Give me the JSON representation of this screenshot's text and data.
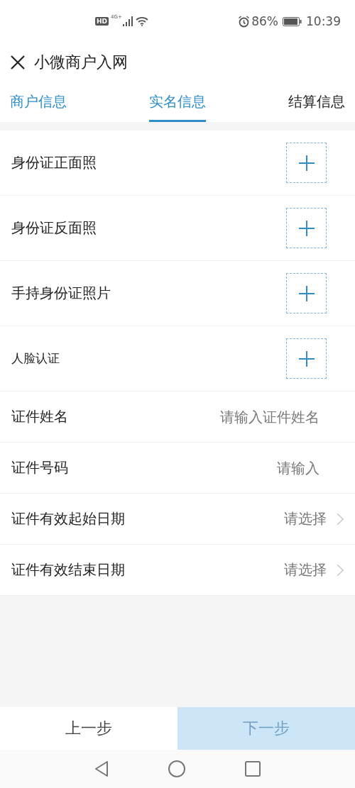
{
  "status_bar": {
    "hd": "HD",
    "network": "4G+",
    "battery": "86%",
    "time": "10:39"
  },
  "header": {
    "title": "小微商户入网"
  },
  "tabs": [
    {
      "label": "商户信息",
      "selected": false,
      "completed": true
    },
    {
      "label": "实名信息",
      "selected": true,
      "completed": false
    },
    {
      "label": "结算信息",
      "selected": false,
      "completed": false
    }
  ],
  "form": [
    {
      "kind": "upload",
      "label": "身份证正面照",
      "small": false
    },
    {
      "kind": "upload",
      "label": "身份证反面照",
      "small": false
    },
    {
      "kind": "upload",
      "label": "手持身份证照片",
      "small": false
    },
    {
      "kind": "upload",
      "label": "人脸认证",
      "small": true
    },
    {
      "kind": "input",
      "label": "证件姓名",
      "placeholder": "请输入证件姓名"
    },
    {
      "kind": "input",
      "label": "证件号码",
      "placeholder": "请输入"
    },
    {
      "kind": "select",
      "label": "证件有效起始日期",
      "placeholder": "请选择"
    },
    {
      "kind": "select",
      "label": "证件有效结束日期",
      "placeholder": "请选择"
    }
  ],
  "footer": {
    "prev": {
      "label": "上一步",
      "disabled": false
    },
    "next": {
      "label": "下一步",
      "disabled": true
    }
  }
}
